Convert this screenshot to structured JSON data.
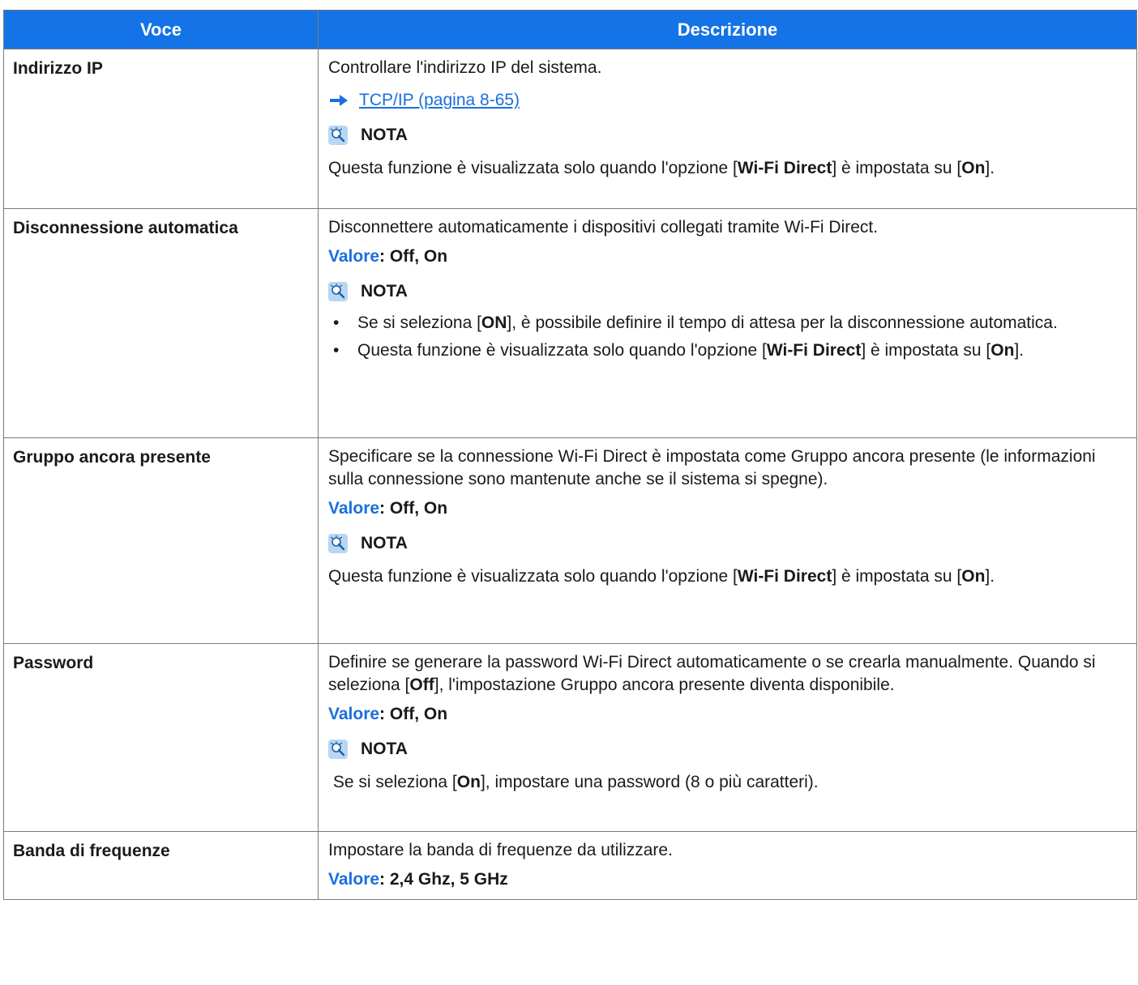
{
  "header": {
    "col1": "Voce",
    "col2": "Descrizione"
  },
  "common": {
    "nota_label": "NOTA",
    "valore_label": "Valore",
    "valore_sep": ": "
  },
  "rows": [
    {
      "voce": "Indirizzo IP",
      "desc": "Controllare l'indirizzo IP del sistema.",
      "link": "TCP/IP (pagina 8-65)",
      "note": {
        "pre": "Questa funzione è visualizzata solo quando l'opzione [",
        "b1": "Wi-Fi Direct",
        "mid": "] è impostata su [",
        "b2": "On",
        "post": "]."
      }
    },
    {
      "voce": "Disconnessione automatica",
      "desc": "Disconnettere automaticamente i dispositivi collegati tramite Wi-Fi Direct.",
      "valore": "Off, On",
      "bullets": [
        {
          "pre": "Se si seleziona [",
          "b1": "ON",
          "post": "], è possibile definire il tempo di attesa per la disconnessione automatica."
        },
        {
          "pre": "Questa funzione è visualizzata solo quando l'opzione [",
          "b1": "Wi-Fi Direct",
          "mid": "] è impostata su [",
          "b2": "On",
          "post": "]."
        }
      ]
    },
    {
      "voce": "Gruppo ancora presente",
      "desc": "Specificare se la connessione Wi-Fi Direct è impostata come Gruppo ancora presente (le informazioni sulla connessione sono mantenute anche se il sistema si spegne).",
      "valore": "Off, On",
      "note": {
        "pre": "Questa funzione è visualizzata solo quando l'opzione [",
        "b1": "Wi-Fi Direct",
        "mid": "] è impostata su [",
        "b2": "On",
        "post": "]."
      }
    },
    {
      "voce": "Password",
      "desc_pre": "Definire se generare la password Wi-Fi Direct automaticamente o se crearla manualmente. Quando si seleziona [",
      "desc_b": "Off",
      "desc_post": "], l'impostazione Gruppo ancora presente diventa disponibile.",
      "valore": "Off, On",
      "note": {
        "pre": " Se si seleziona [",
        "b1": "On",
        "post": "], impostare una password (8 o più caratteri)."
      }
    },
    {
      "voce": "Banda di frequenze",
      "desc": "Impostare la banda di frequenze da utilizzare.",
      "valore": "2,4 Ghz, 5 GHz"
    }
  ]
}
